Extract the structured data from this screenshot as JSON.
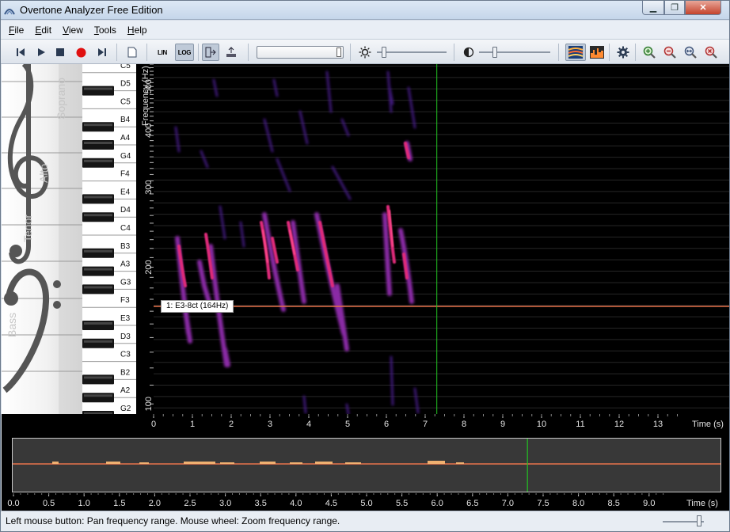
{
  "window": {
    "title": "Overtone Analyzer Free Edition"
  },
  "menu": [
    {
      "label": "File"
    },
    {
      "label": "Edit"
    },
    {
      "label": "View"
    },
    {
      "label": "Tools"
    },
    {
      "label": "Help"
    }
  ],
  "toolbar": {
    "lin_label": "LIN",
    "log_label": "LOG",
    "scale_mode": "log"
  },
  "staff": {
    "voices": [
      "Soprano",
      "Alto",
      "Tenor",
      "Bass"
    ]
  },
  "keyboard": {
    "notes": [
      "C5",
      "D5",
      "C5",
      "B4",
      "A4",
      "G4",
      "F4",
      "E4",
      "D4",
      "C4",
      "B3",
      "A3",
      "G3",
      "F3",
      "E3",
      "D3",
      "C3",
      "B2",
      "A2",
      "G2"
    ]
  },
  "spectrogram": {
    "frequency_axis_title": "Frequency (Hz)",
    "frequency_ticks": [
      "500",
      "400",
      "300",
      "200",
      "100"
    ],
    "time_axis_title": "Time (s)",
    "time_ticks": [
      "0",
      "1",
      "2",
      "3",
      "4",
      "5",
      "6",
      "7",
      "8",
      "9",
      "10",
      "11",
      "12",
      "13"
    ],
    "cursor_time_s": 7.3,
    "marker_label": "1: E3-8ct (164Hz)",
    "marker_frequency_hz": 164,
    "colors": {
      "cursor": "#22c322",
      "marker": "#e8724a",
      "energy_high": "#ff2e7a",
      "energy_low": "#5a1fa0"
    }
  },
  "overview": {
    "time_axis_title": "Time (s)",
    "time_ticks": [
      "0.0",
      "0.5",
      "1.0",
      "1.5",
      "2.0",
      "2.5",
      "3.0",
      "3.5",
      "4.0",
      "4.5",
      "5.0",
      "5.5",
      "6.0",
      "6.5",
      "7.0",
      "7.5",
      "8.0",
      "8.5",
      "9.0"
    ],
    "cursor_time_s": 7.3
  },
  "status": {
    "text": "Left mouse button: Pan frequency range. Mouse wheel: Zoom frequency range."
  }
}
